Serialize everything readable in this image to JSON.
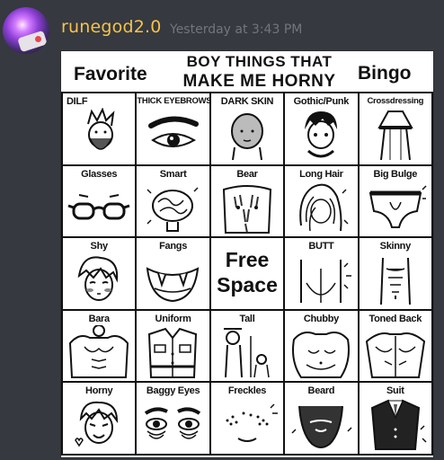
{
  "message": {
    "username": "runegod2.0",
    "timestamp": "Yesterday at 3:43 PM"
  },
  "bingo": {
    "header": {
      "left": "Favorite",
      "middle_line1": "BOY THINGS THAT",
      "middle_line2": "MAKE ME HORNY",
      "right": "Bingo"
    },
    "cells": [
      {
        "label": "DILF",
        "icon": "bearded-man-icon"
      },
      {
        "label": "THICK EYEBROWS",
        "icon": "eyebrow-eye-icon"
      },
      {
        "label": "DARK SKIN",
        "icon": "bald-head-icon"
      },
      {
        "label": "Gothic/Punk",
        "icon": "goth-boy-icon"
      },
      {
        "label": "Crossdressing",
        "icon": "skirt-legs-icon"
      },
      {
        "label": "Glasses",
        "icon": "glasses-icon"
      },
      {
        "label": "Smart",
        "icon": "brain-icon"
      },
      {
        "label": "Bear",
        "icon": "hairy-chest-icon"
      },
      {
        "label": "Long Hair",
        "icon": "long-hair-icon"
      },
      {
        "label": "Big Bulge",
        "icon": "underwear-icon"
      },
      {
        "label": "Shy",
        "icon": "blushing-face-icon"
      },
      {
        "label": "Fangs",
        "icon": "fangs-mouth-icon"
      },
      {
        "label": "Free Space",
        "icon": "free-space"
      },
      {
        "label": "BUTT",
        "icon": "butt-icon"
      },
      {
        "label": "Skinny",
        "icon": "skinny-torso-icon"
      },
      {
        "label": "Bara",
        "icon": "muscular-man-icon"
      },
      {
        "label": "Uniform",
        "icon": "uniform-icon"
      },
      {
        "label": "Tall",
        "icon": "tall-person-icon"
      },
      {
        "label": "Chubby",
        "icon": "chubby-torso-icon"
      },
      {
        "label": "Toned Back",
        "icon": "toned-back-icon"
      },
      {
        "label": "Horny",
        "icon": "horny-face-icon"
      },
      {
        "label": "Baggy Eyes",
        "icon": "baggy-eyes-icon"
      },
      {
        "label": "Freckles",
        "icon": "freckles-icon"
      },
      {
        "label": "Beard",
        "icon": "beard-icon"
      },
      {
        "label": "Suit",
        "icon": "suit-icon"
      }
    ]
  }
}
